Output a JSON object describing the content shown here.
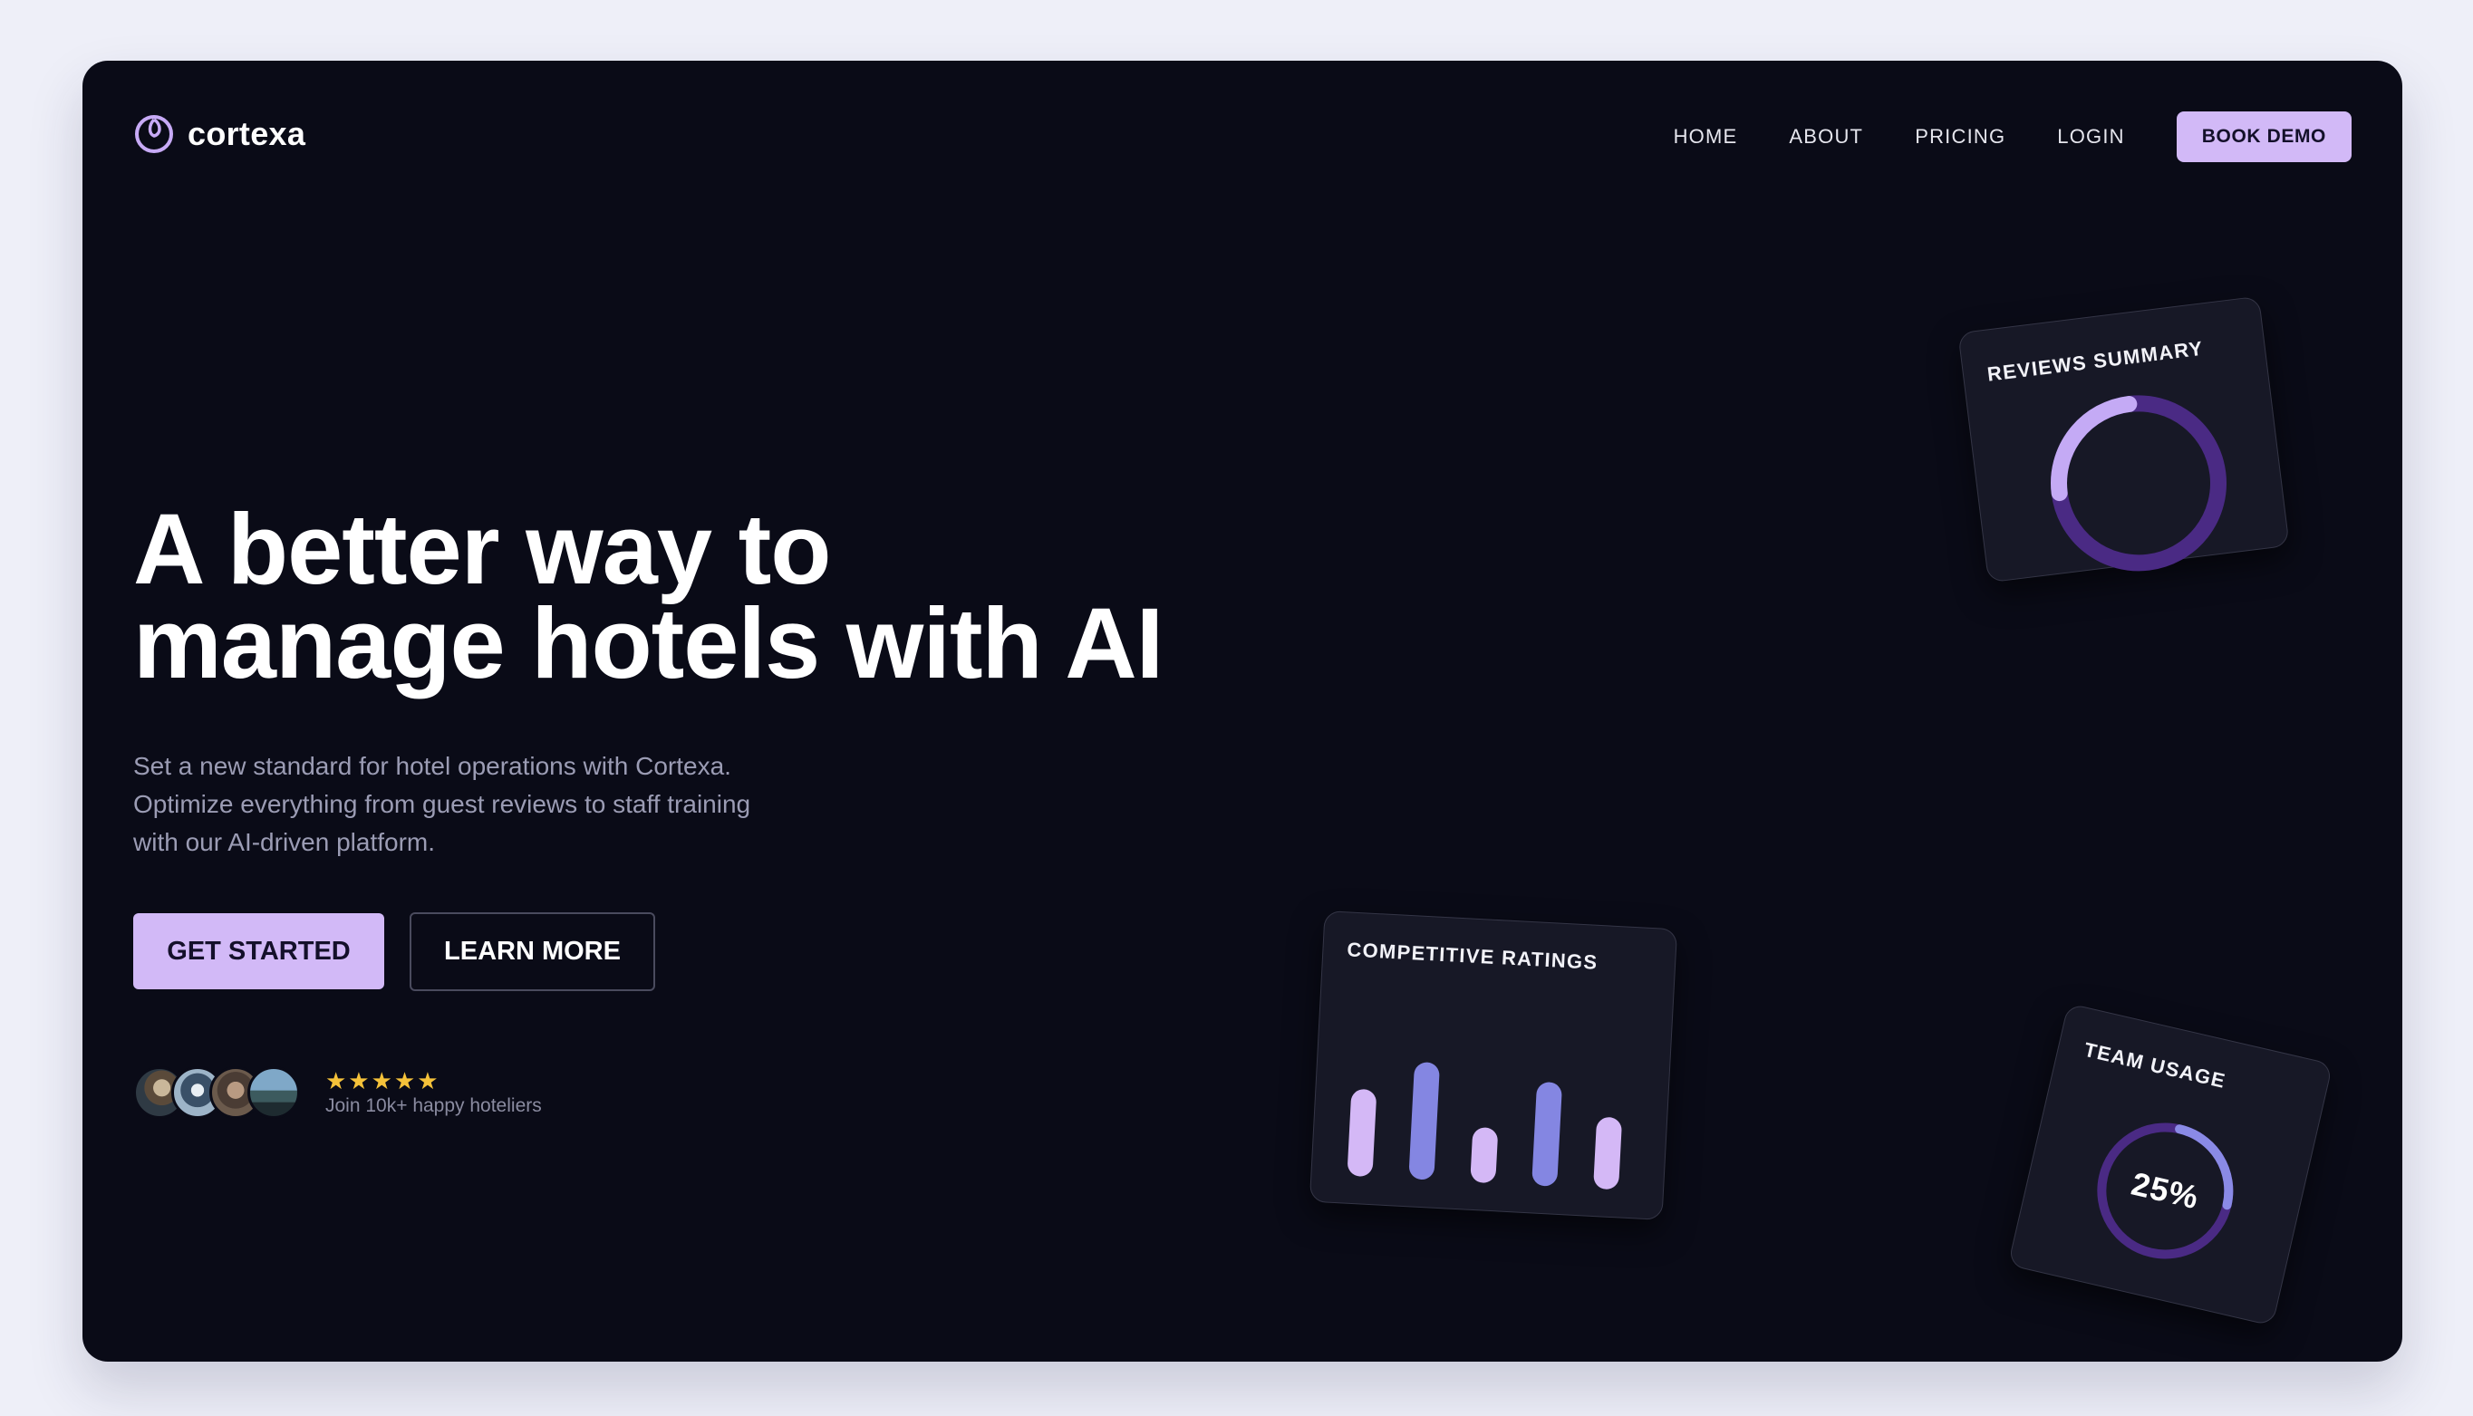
{
  "brand": {
    "name": "cortexa",
    "icon": "spiral-logo-icon",
    "accent": "#d2b9f7"
  },
  "nav": {
    "links": [
      "HOME",
      "ABOUT",
      "PRICING",
      "LOGIN"
    ],
    "cta": "BOOK DEMO"
  },
  "hero": {
    "title_lines": [
      "A better way to",
      "manage hotels with AI"
    ],
    "subtitle_lines": [
      "Set a new standard for hotel operations with Cortexa.",
      "Optimize everything from guest reviews to staff training",
      "with our AI-driven platform."
    ],
    "primary_button": "GET STARTED",
    "secondary_button": "LEARN MORE"
  },
  "social_proof": {
    "stars": "★★★★★",
    "label": "Join 10k+ happy hoteliers",
    "avatar_count": 4
  },
  "cards": {
    "reviews_summary": {
      "title": "REVIEWS SUMMARY",
      "ring_fraction": 0.25
    },
    "competitive_ratings": {
      "title": "COMPETITIVE RATINGS",
      "bar_levels": [
        0.52,
        0.7,
        0.33,
        0.62,
        0.43
      ]
    },
    "team_usage": {
      "title": "TEAM USAGE",
      "value": "25%",
      "fraction": 0.25
    }
  },
  "colors": {
    "ring_track": "#4a2a84",
    "ring_fill": "#c4aaf5",
    "bar_light": "#d4b8f6",
    "bar_blue": "#8486e2",
    "star": "#f5c23a"
  }
}
